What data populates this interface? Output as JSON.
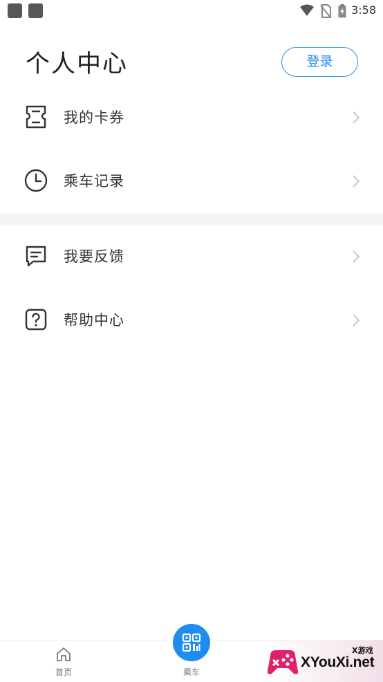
{
  "status_bar": {
    "time": "3:58"
  },
  "header": {
    "title": "个人中心",
    "login_label": "登录"
  },
  "menu": {
    "group1": [
      {
        "label": "我的卡券",
        "icon": "ticket-icon"
      },
      {
        "label": "乘车记录",
        "icon": "clock-icon"
      }
    ],
    "group2": [
      {
        "label": "我要反馈",
        "icon": "message-icon"
      },
      {
        "label": "帮助中心",
        "icon": "help-icon"
      }
    ]
  },
  "bottom_nav": {
    "home_label": "首页",
    "ride_label": "乘车"
  },
  "watermark": {
    "text": "XYouXi.net",
    "small": "X游戏"
  },
  "colors": {
    "accent": "#1e8cf0",
    "text": "#333333",
    "divider": "#f5f5f5"
  }
}
